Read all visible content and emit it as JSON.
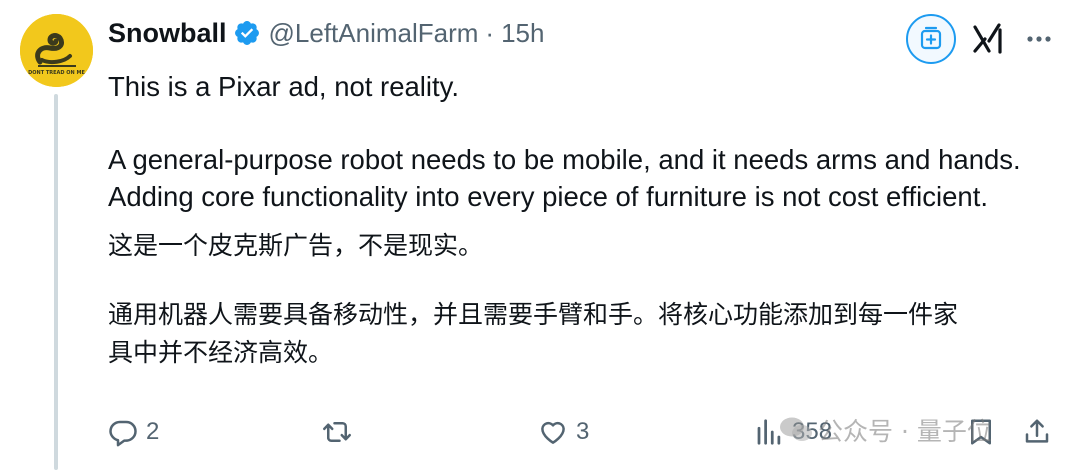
{
  "tweet": {
    "author_name": "Snowball",
    "handle": "@LeftAnimalFarm",
    "separator": "·",
    "time": "15h",
    "avatar_text": "DONT TREAD ON ME",
    "paragraphs": [
      "This is a Pixar ad, not reality.",
      "A general-purpose robot needs to be mobile, and it needs arms and hands.\nAdding core functionality into every piece of furniture is not cost efficient.",
      "这是一个皮克斯广告，不是现实。",
      "通用机器人需要具备移动性，并且需要手臂和手。将核心功能添加到每一件家\n具中并不经济高效。"
    ]
  },
  "actions": {
    "replies": "2",
    "retweets": "",
    "likes": "3",
    "views": "358"
  },
  "watermark": {
    "text": "公众号 · 量子位"
  },
  "colors": {
    "accent": "#1d9bf0",
    "text": "#0f1419",
    "secondary": "#536471",
    "thread_line": "#cfd9de"
  },
  "icons": [
    "verified-badge-icon",
    "grok-icon",
    "xai-icon",
    "more-icon",
    "reply-icon",
    "retweet-icon",
    "like-icon",
    "views-icon",
    "bookmark-icon",
    "share-icon",
    "wechat-icon"
  ]
}
